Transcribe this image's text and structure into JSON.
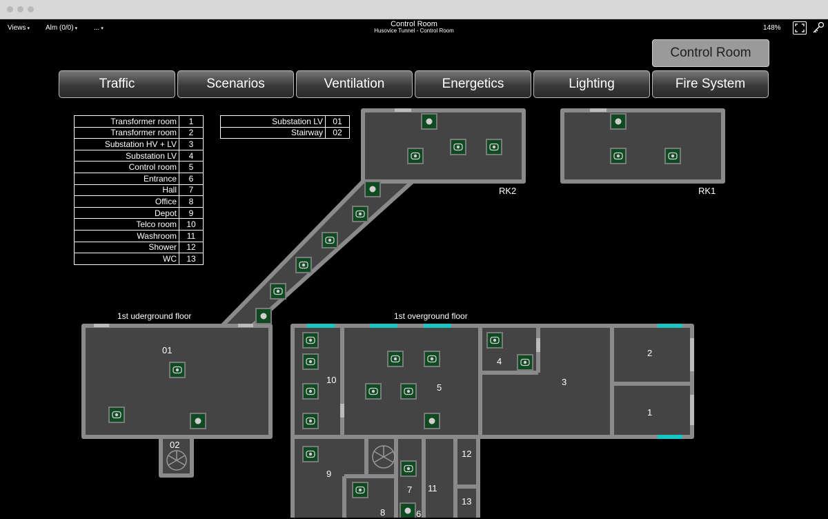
{
  "toolbar": {
    "views": "Views",
    "alarms": "Alm (0/0)",
    "more": "...",
    "title": "Control Room",
    "subtitle": "Husovice Tunnel - Control Room",
    "zoom": "148%"
  },
  "nav": {
    "control_room": "Control Room",
    "tabs": [
      "Traffic",
      "Scenarios",
      "Ventilation",
      "Energetics",
      "Lighting",
      "Fire System"
    ]
  },
  "legend_main": [
    {
      "name": "Transformer room",
      "num": "1"
    },
    {
      "name": "Transformer room",
      "num": "2"
    },
    {
      "name": "Substation HV + LV",
      "num": "3"
    },
    {
      "name": "Substation LV",
      "num": "4"
    },
    {
      "name": "Control room",
      "num": "5"
    },
    {
      "name": "Entrance",
      "num": "6"
    },
    {
      "name": "Hall",
      "num": "7"
    },
    {
      "name": "Office",
      "num": "8"
    },
    {
      "name": "Depot",
      "num": "9"
    },
    {
      "name": "Telco room",
      "num": "10"
    },
    {
      "name": "Washroom",
      "num": "11"
    },
    {
      "name": "Shower",
      "num": "12"
    },
    {
      "name": "WC",
      "num": "13"
    }
  ],
  "legend_underground": [
    {
      "name": "Substation LV",
      "num": "01"
    },
    {
      "name": "Stairway",
      "num": "02"
    }
  ],
  "floors": {
    "underground": "1st uderground floor",
    "overground": "1st overground floor"
  },
  "rooms": [
    "RK2",
    "RK1",
    "01",
    "02",
    "10",
    "5",
    "4",
    "3",
    "2",
    "1",
    "9",
    "7",
    "11",
    "12",
    "13",
    "8",
    "6"
  ],
  "colors": {
    "floor": "#444444",
    "wall": "#8a8a8a",
    "sensor_fill": "#0f4a22",
    "sensor_border": "#7a7a7a",
    "door_open": "#19c4c4"
  }
}
